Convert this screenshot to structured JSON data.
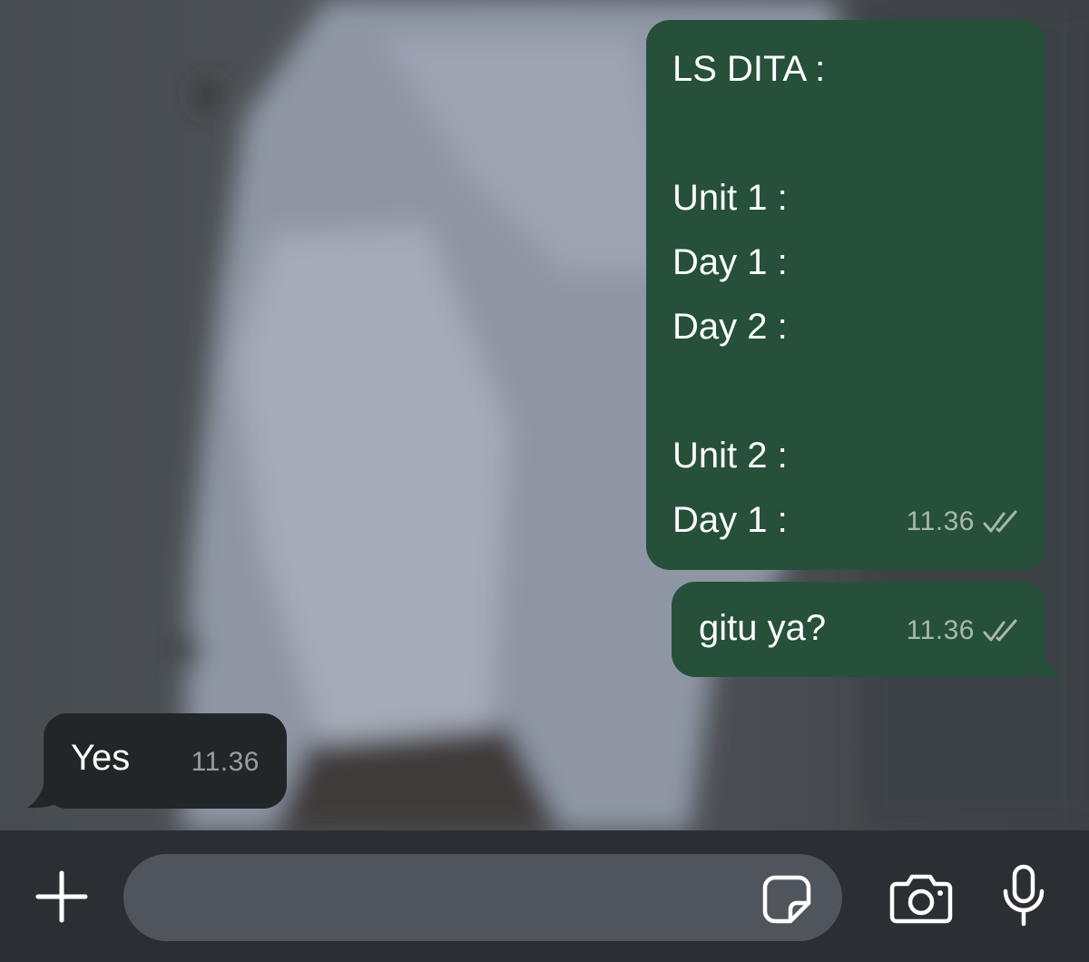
{
  "chat": {
    "messages": [
      {
        "direction": "outgoing",
        "lines": [
          "LS DITA :",
          "",
          "Unit 1 :",
          "Day 1 :",
          "Day 2 :",
          "",
          "Unit 2 :",
          "Day 1 :"
        ],
        "time": "11.36",
        "status_icon": "double-check-read-icon"
      },
      {
        "direction": "outgoing",
        "lines": [
          "gitu ya?"
        ],
        "time": "11.36",
        "status_icon": "double-check-read-icon"
      },
      {
        "direction": "incoming",
        "lines": [
          "Yes"
        ],
        "time": "11.36"
      }
    ]
  },
  "composer": {
    "text": "",
    "icons": [
      "plus-icon",
      "sticker-icon",
      "camera-icon",
      "microphone-icon"
    ]
  },
  "colors": {
    "outgoing_bubble": "#27503b",
    "incoming_bubble": "#232629",
    "input_bar": "#2b2f34",
    "compose_field": "#50555b"
  }
}
